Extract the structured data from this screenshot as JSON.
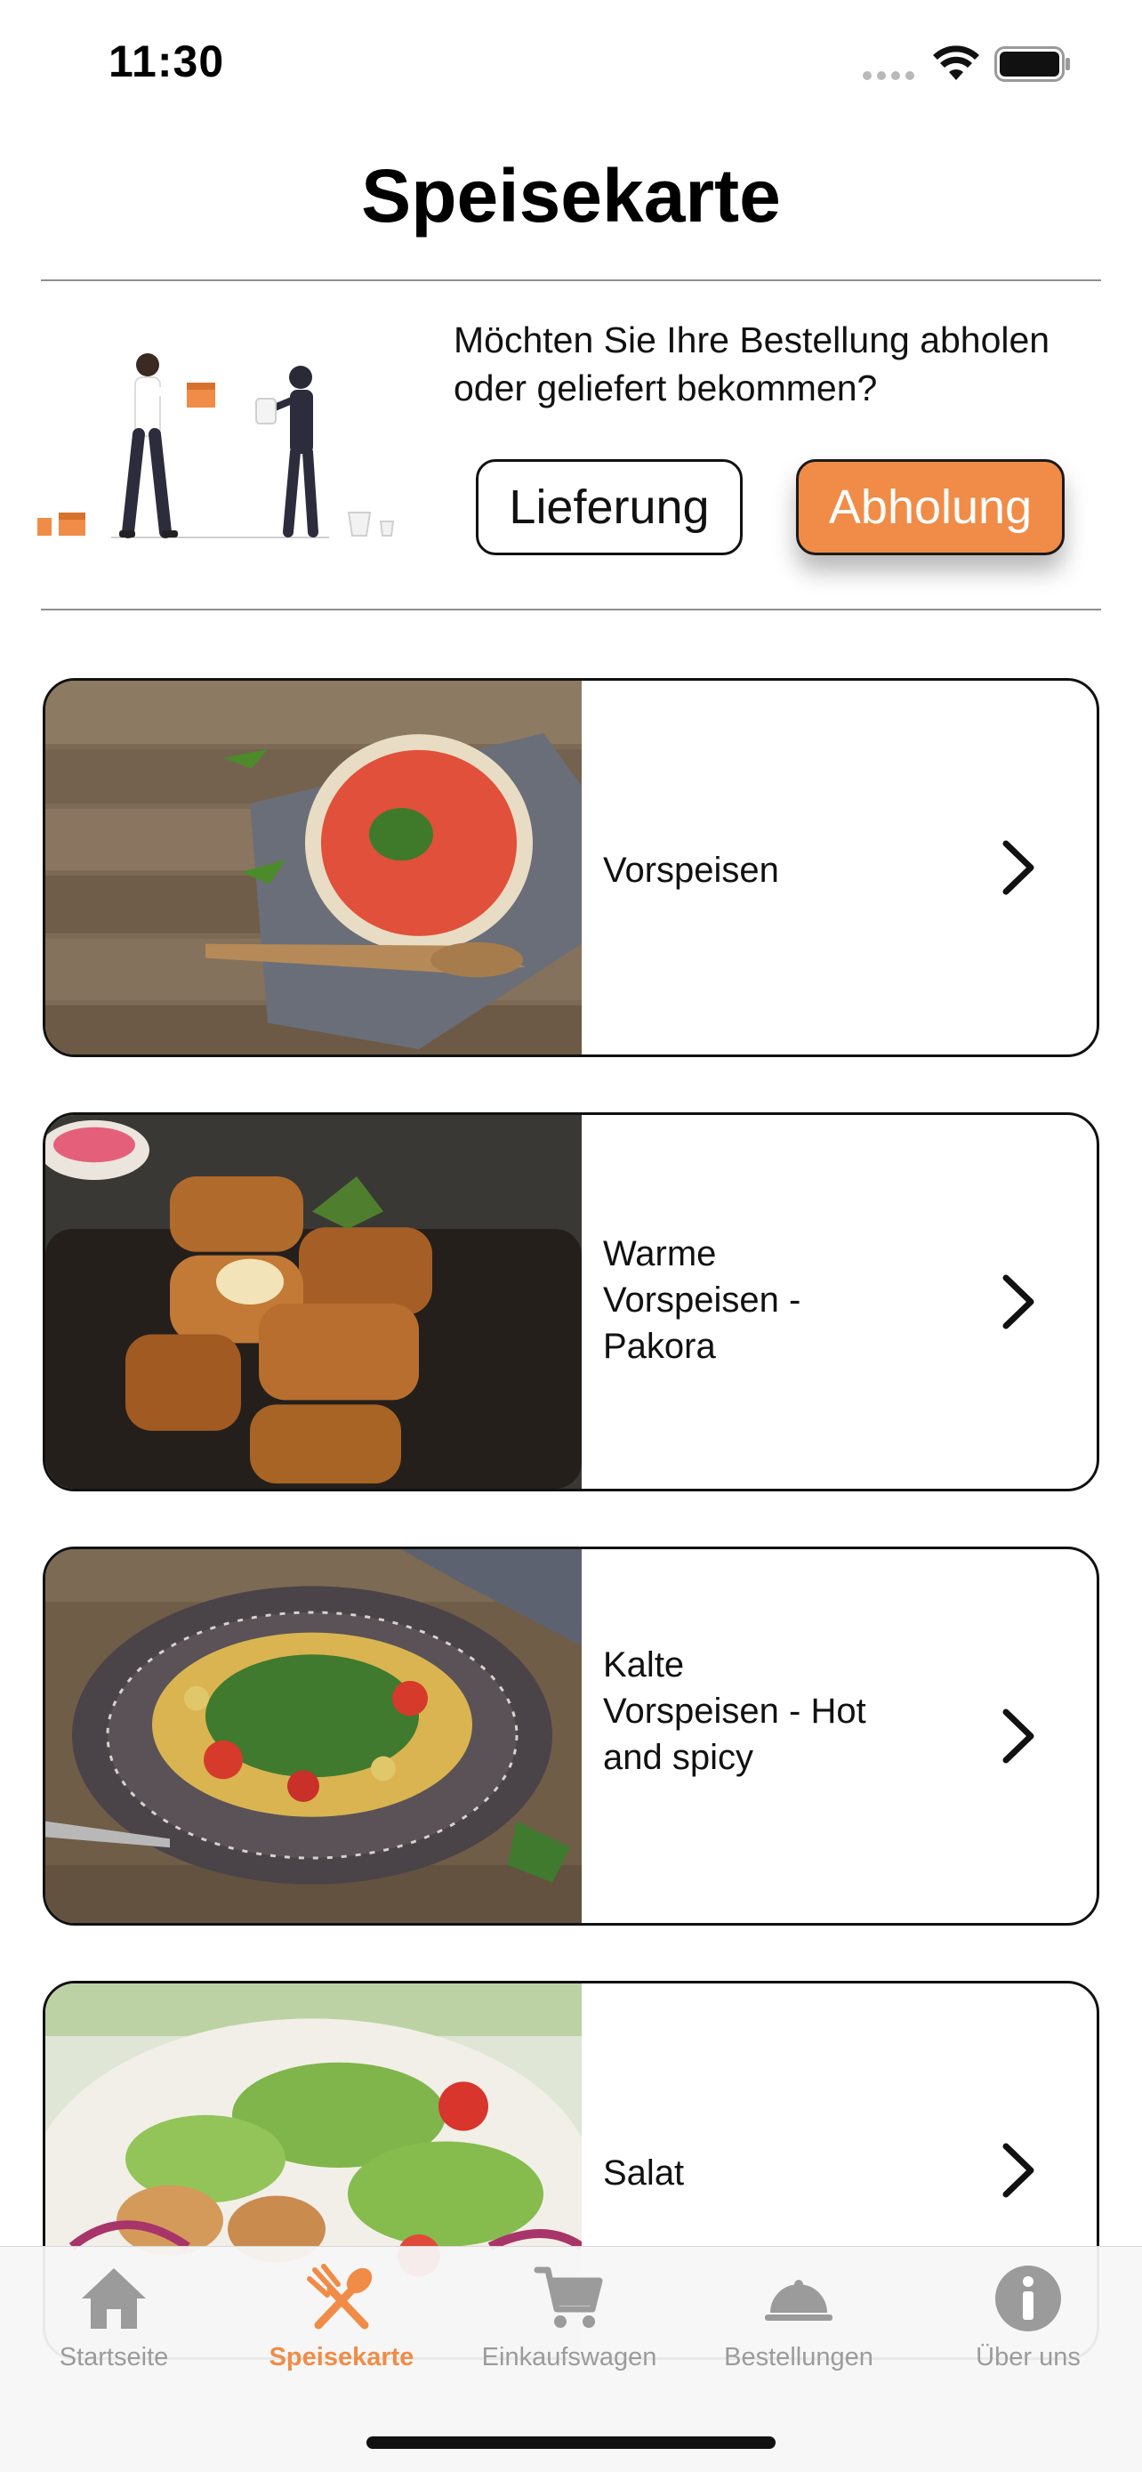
{
  "status_bar": {
    "time": "11:30"
  },
  "header": {
    "title": "Speisekarte"
  },
  "delivery": {
    "question": "Möchten Sie Ihre Bestellung abholen oder geliefert bekommen?",
    "delivery_label": "Lieferung",
    "pickup_label": "Abholung",
    "selected": "Abholung"
  },
  "categories": [
    {
      "label": "Vorspeisen",
      "image": "tomato-soup"
    },
    {
      "label": "Warme Vorspeisen - Pakora",
      "image": "fried-pakora"
    },
    {
      "label": "Kalte Vorspeisen - Hot and spicy",
      "image": "chickpea-salad"
    },
    {
      "label": "Salat",
      "image": "mixed-salad"
    }
  ],
  "tabs": [
    {
      "label": "Startseite",
      "icon": "home-icon"
    },
    {
      "label": "Speisekarte",
      "icon": "cutlery-icon",
      "active": true
    },
    {
      "label": "Einkaufswagen",
      "icon": "cart-icon"
    },
    {
      "label": "Bestellungen",
      "icon": "cloche-icon"
    },
    {
      "label": "Über uns",
      "icon": "info-icon"
    }
  ],
  "colors": {
    "accent": "#f08c47",
    "inactive_tab": "#9b9b9b",
    "border": "#111111"
  }
}
